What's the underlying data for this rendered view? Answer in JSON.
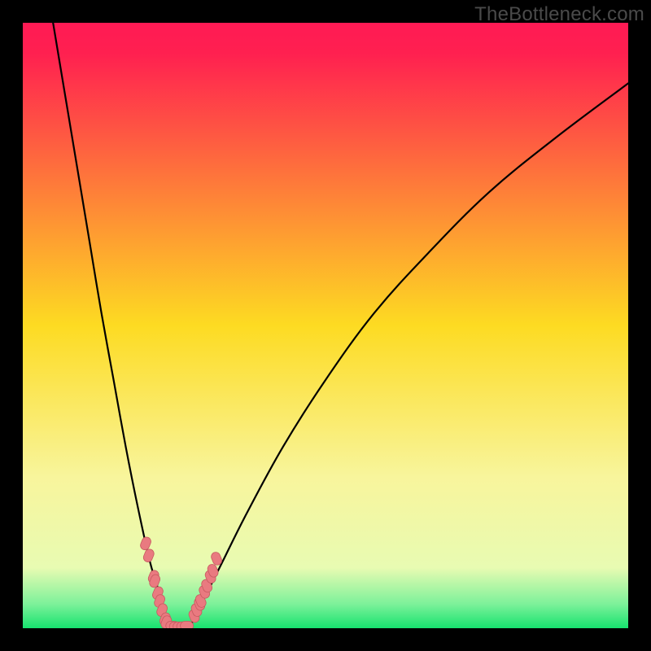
{
  "watermark": "TheBottleneck.com",
  "chart_data": {
    "type": "line",
    "title": "",
    "xlabel": "",
    "ylabel": "",
    "xlim": [
      0,
      100
    ],
    "ylim": [
      0,
      100
    ],
    "grid": false,
    "legend": false,
    "gradient_stops": [
      {
        "offset": 0.0,
        "color": "#ff1a54"
      },
      {
        "offset": 0.05,
        "color": "#ff2050"
      },
      {
        "offset": 0.5,
        "color": "#fddb22"
      },
      {
        "offset": 0.75,
        "color": "#f8f59c"
      },
      {
        "offset": 0.9,
        "color": "#e8fbb2"
      },
      {
        "offset": 0.96,
        "color": "#7df19a"
      },
      {
        "offset": 1.0,
        "color": "#17e36f"
      }
    ],
    "series": [
      {
        "name": "left-curve",
        "type": "curve",
        "x": [
          5,
          7,
          9,
          11,
          13,
          15,
          17,
          19,
          21,
          22.5,
          23.5,
          24,
          24.5
        ],
        "y": [
          100,
          88,
          76,
          64,
          52,
          41,
          30,
          20,
          11,
          6,
          2.5,
          1,
          0
        ]
      },
      {
        "name": "right-curve",
        "type": "curve",
        "x": [
          27.5,
          28,
          29,
          30.5,
          33,
          37,
          43,
          50,
          58,
          67,
          77,
          88,
          100
        ],
        "y": [
          0,
          1,
          3,
          6,
          11,
          19,
          30,
          41,
          52,
          62,
          72,
          81,
          90
        ]
      },
      {
        "name": "left-markers",
        "type": "scatter",
        "x": [
          20.3,
          20.8,
          21.6,
          21.8,
          22.3,
          22.6,
          23.0,
          23.5,
          23.7
        ],
        "y": [
          14.0,
          12.0,
          8.5,
          7.8,
          5.8,
          4.5,
          3.0,
          1.5,
          1.0
        ]
      },
      {
        "name": "right-markers",
        "type": "scatter",
        "x": [
          28.3,
          28.7,
          29.2,
          29.4,
          30.0,
          30.4,
          31.0,
          31.4,
          32.0
        ],
        "y": [
          2.0,
          3.0,
          4.0,
          4.5,
          6.0,
          7.0,
          8.5,
          9.5,
          11.5
        ]
      },
      {
        "name": "floor-markers",
        "type": "scatter",
        "x": [
          24.7,
          25.3,
          25.9,
          26.5,
          27.1
        ],
        "y": [
          0.4,
          0.3,
          0.3,
          0.3,
          0.4
        ]
      }
    ],
    "colors": {
      "curve": "#000000",
      "marker_fill": "#e97a80",
      "marker_stroke": "#c85a60"
    }
  }
}
